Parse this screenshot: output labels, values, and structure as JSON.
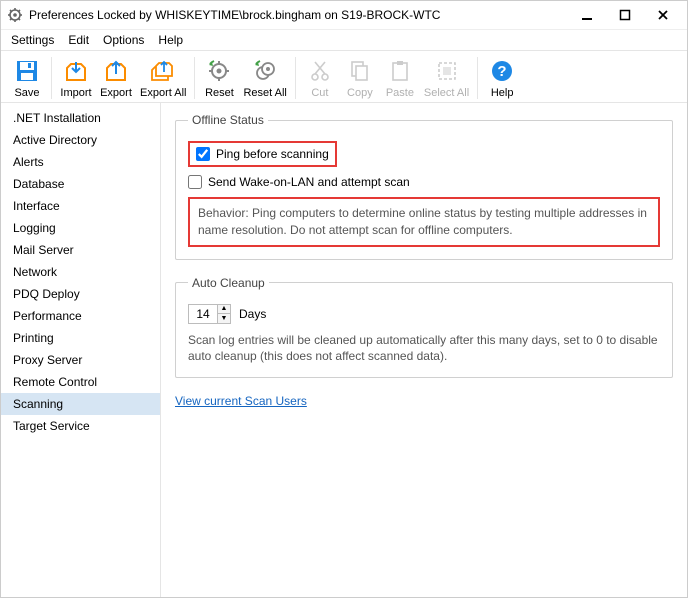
{
  "window": {
    "title": "Preferences Locked by WHISKEYTIME\\brock.bingham on S19-BROCK-WTC"
  },
  "menu": {
    "settings": "Settings",
    "edit": "Edit",
    "options": "Options",
    "help": "Help"
  },
  "toolbar": {
    "save": "Save",
    "import": "Import",
    "export": "Export",
    "export_all": "Export All",
    "reset": "Reset",
    "reset_all": "Reset All",
    "cut": "Cut",
    "copy": "Copy",
    "paste": "Paste",
    "select_all": "Select All",
    "help": "Help"
  },
  "sidebar": {
    "items": [
      ".NET Installation",
      "Active Directory",
      "Alerts",
      "Database",
      "Interface",
      "Logging",
      "Mail Server",
      "Network",
      "PDQ Deploy",
      "Performance",
      "Printing",
      "Proxy Server",
      "Remote Control",
      "Scanning",
      "Target Service"
    ],
    "selected": "Scanning"
  },
  "offline": {
    "legend": "Offline Status",
    "ping_label": "Ping before scanning",
    "ping_checked": true,
    "wol_label": "Send Wake-on-LAN and attempt scan",
    "wol_checked": false,
    "behavior": "Behavior: Ping computers to determine online status by testing multiple addresses in name resolution. Do not attempt scan for offline computers."
  },
  "cleanup": {
    "legend": "Auto Cleanup",
    "days_value": "14",
    "days_label": "Days",
    "help": "Scan log entries will be cleaned up automatically after this many days, set to 0 to disable auto cleanup (this does not affect scanned data)."
  },
  "link": {
    "scan_users": "View current Scan Users"
  }
}
